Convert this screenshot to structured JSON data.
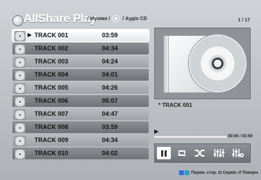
{
  "header": {
    "app_title": "AllShare Play",
    "crumb1": "/ Музика /",
    "crumb2": "/ Аудіо CD",
    "page_count": "1 / 17"
  },
  "tracks": [
    {
      "name": "TRACK 001",
      "time": "03:59"
    },
    {
      "name": "TRACK 002",
      "time": "04:34"
    },
    {
      "name": "TRACK 003",
      "time": "04:24"
    },
    {
      "name": "TRACK 004",
      "time": "04:01"
    },
    {
      "name": "TRACK 005",
      "time": "04:26"
    },
    {
      "name": "TRACK 006",
      "time": "05:07"
    },
    {
      "name": "TRACK 007",
      "time": "04:47"
    },
    {
      "name": "TRACK 008",
      "time": "03:59"
    },
    {
      "name": "TRACK 009",
      "time": "04:34"
    },
    {
      "name": "TRACK 010",
      "time": "04:02"
    }
  ],
  "player": {
    "now_playing": "* TRACK 001",
    "time_display": "00:00 / 03:59",
    "play_state_icon": "play-icon"
  },
  "controls": [
    "pause-icon",
    "repeat-icon",
    "shuffle-icon",
    "equalizer-icon",
    "equalizer-settings-icon"
  ],
  "footer": {
    "page_turn": "Перем. стор.",
    "service": "Сервіс",
    "back": "Поверн."
  },
  "colors": {
    "key_b": "#3a6bd6",
    "key_c": "#28a0c8"
  }
}
